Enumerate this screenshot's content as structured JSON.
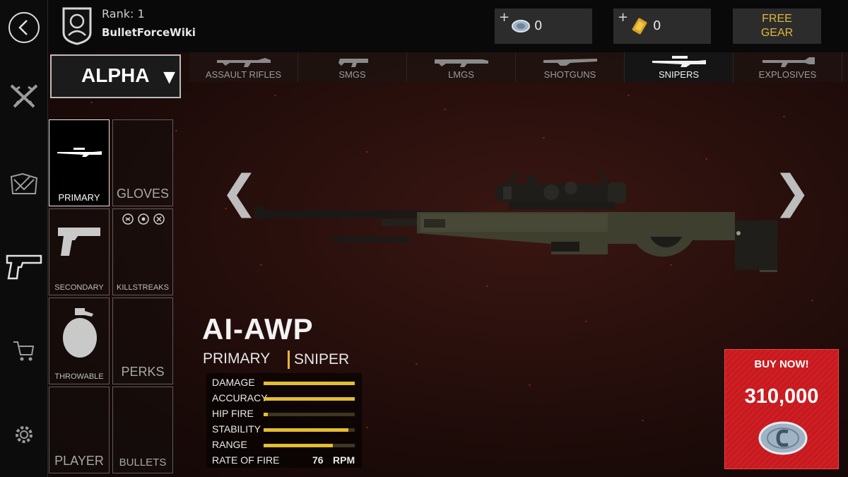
{
  "player": {
    "rank_label": "Rank: 1",
    "username": "BulletForceWiki"
  },
  "currency": {
    "credits": {
      "plus": "+",
      "amount": "0",
      "icon": "credit-coin-icon"
    },
    "gold": {
      "plus": "+",
      "amount": "0",
      "icon": "gold-bar-icon"
    },
    "free_gear_line1": "FREE",
    "free_gear_line2": "GEAR"
  },
  "sidebar": {
    "items": [
      {
        "name": "back",
        "icon": "back-arrow-icon"
      },
      {
        "name": "loadout",
        "icon": "crossed-rifles-icon"
      },
      {
        "name": "scene",
        "icon": "scene-icon"
      },
      {
        "name": "weapons",
        "icon": "pistol-icon"
      },
      {
        "name": "store",
        "icon": "cart-icon"
      },
      {
        "name": "settings",
        "icon": "gear-icon"
      }
    ]
  },
  "class_select": {
    "value": "ALPHA"
  },
  "categories": [
    {
      "label": "ASSAULT RIFLES",
      "active": false
    },
    {
      "label": "SMGS",
      "active": false
    },
    {
      "label": "LMGS",
      "active": false
    },
    {
      "label": "SHOTGUNS",
      "active": false
    },
    {
      "label": "SNIPERS",
      "active": true
    },
    {
      "label": "EXPLOSIVES",
      "active": false
    }
  ],
  "slots": [
    {
      "label": "PRIMARY",
      "active": true
    },
    {
      "label": "GLOVES",
      "active": false
    },
    {
      "label": "SECONDARY",
      "active": false
    },
    {
      "label": "KILLSTREAKS",
      "active": false
    },
    {
      "label": "THROWABLE",
      "active": false
    },
    {
      "label": "PERKS",
      "active": false
    },
    {
      "label": "PLAYER",
      "active": false
    },
    {
      "label": "BULLETS",
      "active": false
    }
  ],
  "nav": {
    "prev": "❮",
    "next": "❯"
  },
  "weapon": {
    "name": "AI-AWP",
    "slot": "PRIMARY",
    "type": "SNIPER",
    "stats": [
      {
        "label": "DAMAGE",
        "value": 1.0
      },
      {
        "label": "ACCURACY",
        "value": 1.0
      },
      {
        "label": "HIP FIRE",
        "value": 0.05
      },
      {
        "label": "STABILITY",
        "value": 0.93
      },
      {
        "label": "RANGE",
        "value": 0.76
      }
    ],
    "rate_of_fire": {
      "label": "RATE OF FIRE",
      "value": "76",
      "unit": "RPM"
    }
  },
  "buy": {
    "label": "BUY NOW!",
    "price": "310,000"
  },
  "colors": {
    "accent": "#e3bd32",
    "buy_red": "#cf1f24",
    "gold_text": "#e0b73a"
  }
}
